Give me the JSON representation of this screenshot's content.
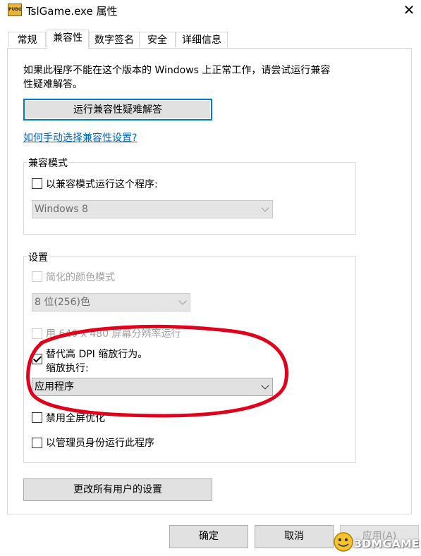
{
  "window": {
    "title": "TslGame.exe 属性",
    "app_icon_text": "PUBG",
    "close_glyph": "✕"
  },
  "tabs": [
    {
      "label": "常规",
      "active": false
    },
    {
      "label": "兼容性",
      "active": true
    },
    {
      "label": "数字签名",
      "active": false
    },
    {
      "label": "安全",
      "active": false
    },
    {
      "label": "详细信息",
      "active": false
    }
  ],
  "compat": {
    "intro_line1": "如果此程序不能在这个版本的 Windows 上正常工作，请尝试运行兼容",
    "intro_line2": "性疑难解答。",
    "troubleshoot_button": "运行兼容性疑难解答",
    "help_link": "如何手动选择兼容性设置?"
  },
  "compat_mode": {
    "group_label": "兼容模式",
    "checkbox_label": "以兼容模式运行这个程序:",
    "checked": false,
    "os_select_value": "Windows 8"
  },
  "settings": {
    "group_label": "设置",
    "reduced_color_label": "简化的颜色模式",
    "color_select_value": "8 位(256)色",
    "res_label": "用 640 x 480 屏幕分辨率运行",
    "dpi_label": "替代高 DPI 缩放行为。",
    "dpi_checked": true,
    "scaling_label": "缩放执行:",
    "scaling_select_value": "应用程序",
    "fullscreen_label": "禁用全屏优化",
    "admin_label": "以管理员身份运行此程序"
  },
  "buttons": {
    "all_users": "更改所有用户的设置",
    "ok": "确定",
    "cancel": "取消",
    "apply": "应用(A)"
  },
  "watermark": {
    "text": "3DMGAME"
  },
  "colors": {
    "annotation_circle": "#e3001b",
    "link": "#0066cc",
    "focus_border": "#0078d7"
  }
}
